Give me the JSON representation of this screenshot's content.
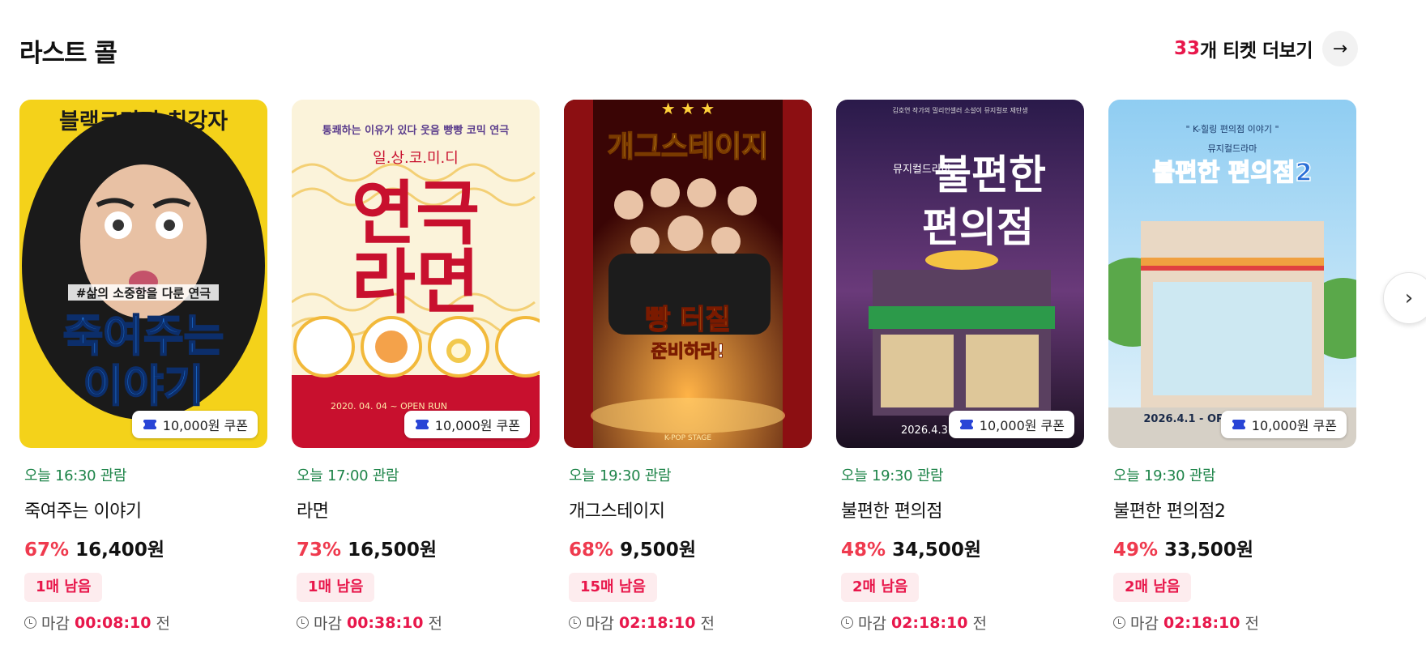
{
  "section": {
    "title": "라스트 콜",
    "more_count": "33",
    "more_label": "개 티켓 더보기",
    "more_icon": "arrow-right-icon",
    "next_icon": "chevron-right-icon"
  },
  "cards": [
    {
      "time": "오늘 16:30 관람",
      "name": "죽여주는 이야기",
      "discount": "67%",
      "price": "16,400원",
      "remain": "1매 남음",
      "deadline_prefix": "마감",
      "countdown": "00:08:10",
      "deadline_suffix": "전",
      "coupon": "10,000원 쿠폰",
      "poster": {
        "headline": "블랙코미디 최강자",
        "tagline": "#삶의 소중함을 다룬 연극",
        "big": "죽여주는",
        "big2": "이야기",
        "colors": {
          "bg": "#f4d21a",
          "accent": "#1d6fd1"
        }
      }
    },
    {
      "time": "오늘 17:00 관람",
      "name": "라면",
      "discount": "73%",
      "price": "16,500원",
      "remain": "1매 남음",
      "deadline_prefix": "마감",
      "countdown": "00:38:10",
      "deadline_suffix": "전",
      "coupon": "10,000원 쿠폰",
      "poster": {
        "headline": "통쾌하는 이유가 있다 웃음 빵빵 코믹 연극",
        "tagline": "일.상.코.미.디",
        "big": "연극",
        "big2": "라면",
        "sub": "2020. 04. 04 ~ OPEN RUN",
        "colors": {
          "bg": "#fbf3da",
          "accent": "#c8102e"
        }
      }
    },
    {
      "time": "오늘 19:30 관람",
      "name": "개그스테이지",
      "discount": "68%",
      "price": "9,500원",
      "remain": "15매 남음",
      "deadline_prefix": "마감",
      "countdown": "02:18:10",
      "deadline_suffix": "전",
      "coupon": "",
      "poster": {
        "headline": "개그스테이지",
        "big": "빵 터질",
        "big2": "준비하라!",
        "sub": "K-POP STAGE",
        "colors": {
          "bg": "#7a0b0b",
          "accent": "#ffd23a"
        }
      }
    },
    {
      "time": "오늘 19:30 관람",
      "name": "불편한 편의점",
      "discount": "48%",
      "price": "34,500원",
      "remain": "2매 남음",
      "deadline_prefix": "마감",
      "countdown": "02:18:10",
      "deadline_suffix": "전",
      "coupon": "10,000원 쿠폰",
      "poster": {
        "headline": "김호연 작가의 밀리언셀러 소설이 뮤지컬로 재탄생",
        "tagline": "뮤지컬드라마",
        "big": "불편한",
        "big2": "편의점",
        "sub": "2026.4.3 - OPEN RUN",
        "colors": {
          "bg": "#3a2458",
          "accent": "#ffffff"
        }
      }
    },
    {
      "time": "오늘 19:30 관람",
      "name": "불편한 편의점2",
      "discount": "49%",
      "price": "33,500원",
      "remain": "2매 남음",
      "deadline_prefix": "마감",
      "countdown": "02:18:10",
      "deadline_suffix": "전",
      "coupon": "10,000원 쿠폰",
      "poster": {
        "headline": "\" K-힐링 편의점 이야기 \"",
        "tagline": "뮤지컬드라마",
        "big": "불편한 편의점2",
        "sub": "2026.4.1 - OPEN RUN 후암씨어터",
        "colors": {
          "bg": "#9ed2f0",
          "accent": "#2a6fd6"
        }
      }
    }
  ]
}
